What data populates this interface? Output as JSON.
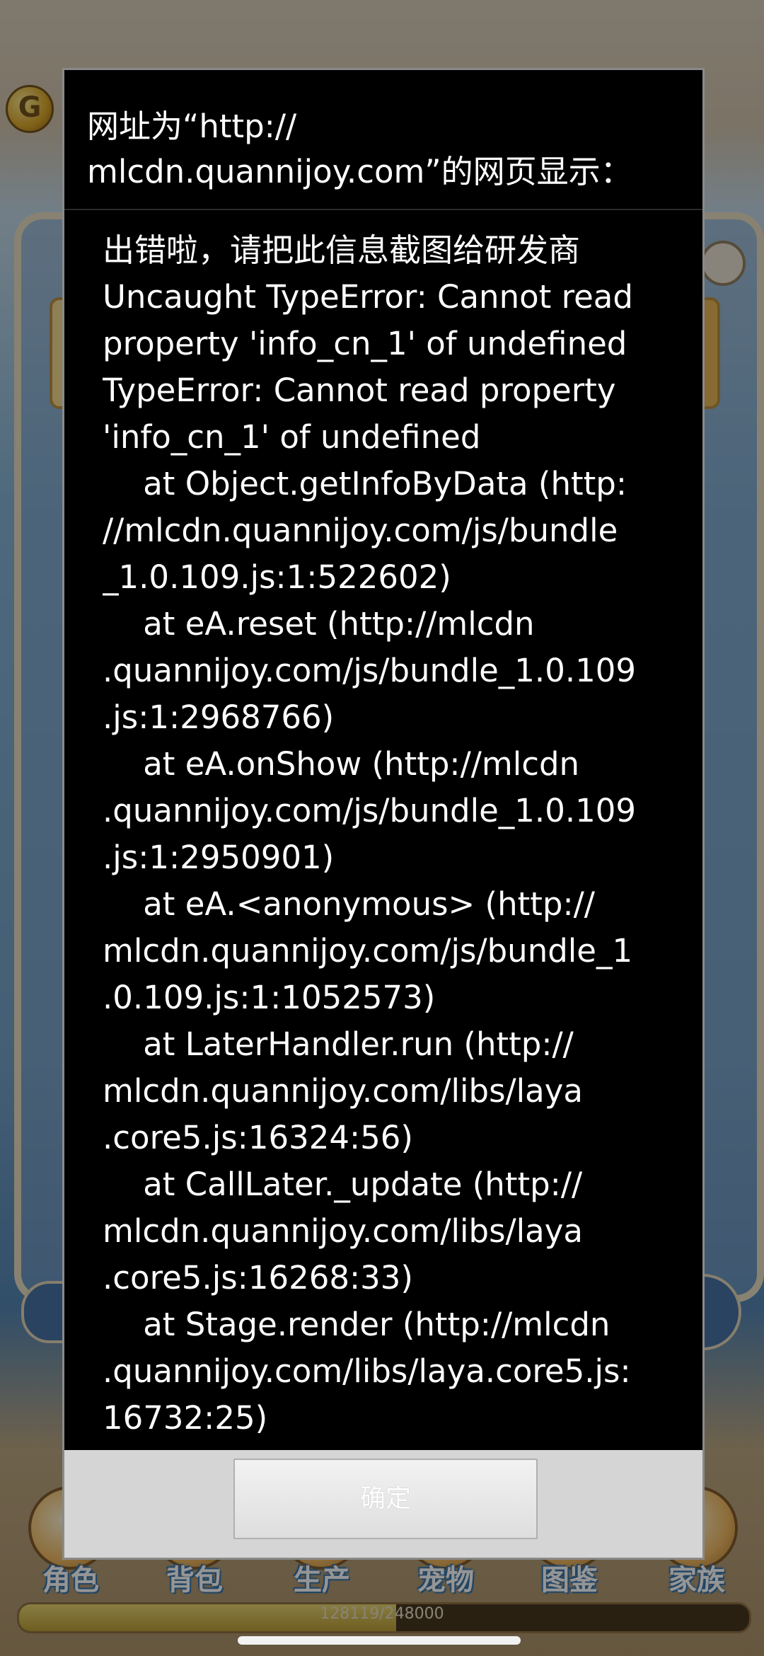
{
  "dialog": {
    "title": "网址为“http://\nmlcdn.quannijoy.com”的网页显示：",
    "message_lines": [
      "出错啦，请把此信息截图给研发商",
      "Uncaught TypeError: Cannot read",
      "property 'info_cn_1' of undefined",
      "TypeError: Cannot read property",
      "'info_cn_1' of undefined",
      "    at Object.getInfoByData (http:",
      "//mlcdn.quannijoy.com/js/bundle",
      "_1.0.109.js:1:522602)",
      "    at eA.reset (http://mlcdn",
      ".quannijoy.com/js/bundle_1.0.109",
      ".js:1:2968766)",
      "    at eA.onShow (http://mlcdn",
      ".quannijoy.com/js/bundle_1.0.109",
      ".js:1:2950901)",
      "    at eA.<anonymous> (http://",
      "mlcdn.quannijoy.com/js/bundle_1",
      ".0.109.js:1:1052573)",
      "    at LaterHandler.run (http://",
      "mlcdn.quannijoy.com/libs/laya",
      ".core5.js:16324:56)",
      "    at CallLater._update (http://",
      "mlcdn.quannijoy.com/libs/laya",
      ".core5.js:16268:33)",
      "    at Stage.render (http://mlcdn",
      ".quannijoy.com/libs/laya.core5.js:",
      "16732:25)"
    ],
    "ok_label": "确定"
  },
  "background": {
    "coin_letter": "G",
    "plus_label": "+",
    "nav": [
      "角色",
      "背包",
      "生产",
      "宠物",
      "图鉴",
      "家族"
    ],
    "xp_text": "128119/248000",
    "xp_fraction": 0.5166
  }
}
